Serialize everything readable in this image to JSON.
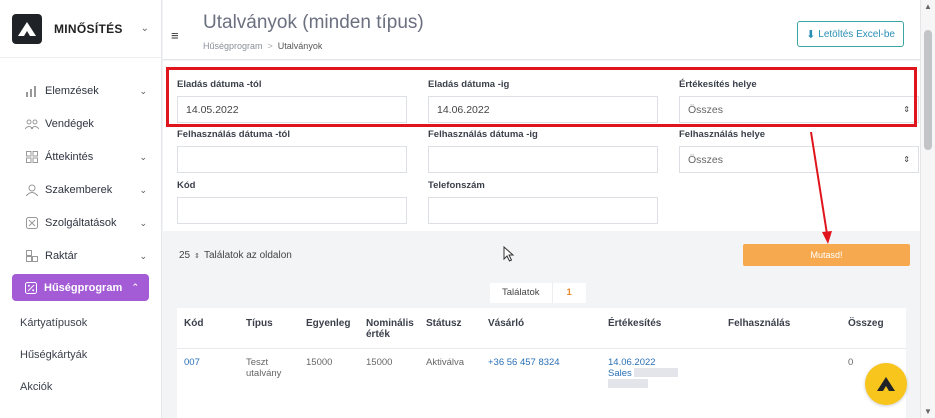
{
  "brand": {
    "name": "MINŐSÍTÉS",
    "logo_icon": "brand-logo-icon"
  },
  "sidebar": {
    "items": [
      {
        "label": "Elemzések",
        "icon": "chart-icon",
        "has_chevron": true
      },
      {
        "label": "Vendégek",
        "icon": "users-icon",
        "has_chevron": false
      },
      {
        "label": "Áttekintés",
        "icon": "grid-icon",
        "has_chevron": true
      },
      {
        "label": "Szakemberek",
        "icon": "user-icon",
        "has_chevron": true
      },
      {
        "label": "Szolgáltatások",
        "icon": "scissors-icon",
        "has_chevron": true
      },
      {
        "label": "Raktár",
        "icon": "boxes-icon",
        "has_chevron": true
      },
      {
        "label": "Hűségprogram",
        "icon": "percent-icon",
        "has_chevron": true,
        "active": true
      }
    ],
    "subitems": [
      "Kártyatípusok",
      "Hűségkártyák",
      "Akciók"
    ],
    "active_color": "#a35bd6"
  },
  "header": {
    "title": "Utalványok (minden típus)",
    "breadcrumb": [
      "Hűségprogram",
      "Utalványok"
    ],
    "breadcrumb_separator": ">",
    "excel_button": "Letöltés Excel-be"
  },
  "filters": {
    "sale_date_from": {
      "label": "Eladás dátuma -tól",
      "value": "14.05.2022"
    },
    "sale_date_to": {
      "label": "Eladás dátuma -ig",
      "value": "14.06.2022"
    },
    "sale_place": {
      "label": "Értékesítés helye",
      "value": "Összes"
    },
    "use_date_from": {
      "label": "Felhasználás dátuma -tól",
      "value": ""
    },
    "use_date_to": {
      "label": "Felhasználás dátuma -ig",
      "value": ""
    },
    "use_place": {
      "label": "Felhasználás helye",
      "value": "Összes"
    },
    "code": {
      "label": "Kód",
      "value": ""
    },
    "phone": {
      "label": "Telefonszám",
      "value": ""
    }
  },
  "controls": {
    "per_page_value": "25",
    "per_page_label": "Találatok az oldalon",
    "show_button": "Mutasd!",
    "show_button_color": "#f7a94f"
  },
  "results": {
    "tab_label": "Találatok",
    "count": "1"
  },
  "table": {
    "headers": [
      "Kód",
      "Típus",
      "Egyenleg",
      "Nominális érték",
      "Státusz",
      "Vásárló",
      "Értékesítés",
      "Felhasználás",
      "Összeg"
    ],
    "rows": [
      {
        "code": "007",
        "type": "Teszt utalvány",
        "balance": "15000",
        "nominal": "15000",
        "status": "Aktiválva",
        "buyer": "+36 56 457 8324",
        "sale_date": "14.06.2022",
        "sale_place": "Sales",
        "usage": "",
        "amount": "0"
      }
    ]
  },
  "colors": {
    "highlight": "#e0141c",
    "link": "#2a6fb5",
    "fab": "#f8c51d"
  }
}
